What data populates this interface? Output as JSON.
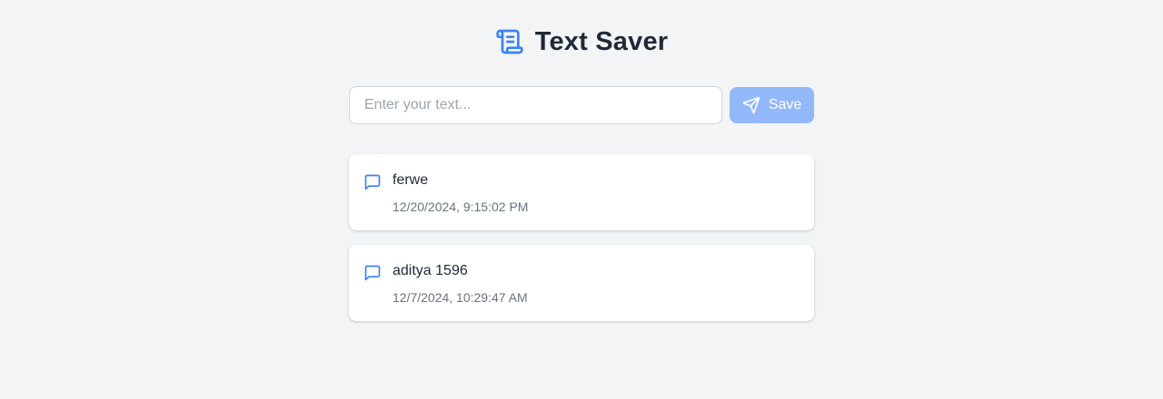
{
  "app": {
    "title": "Text Saver",
    "logo_icon": "scroll-icon",
    "accent_color": "#3b82f6"
  },
  "form": {
    "input_value": "",
    "input_placeholder": "Enter your text...",
    "save_label": "Save",
    "save_icon": "send-icon",
    "save_button_color": "#93b8f9"
  },
  "entries": [
    {
      "text": "ferwe",
      "timestamp": "12/20/2024, 9:15:02 PM",
      "icon": "message-square-icon"
    },
    {
      "text": "aditya 1596",
      "timestamp": "12/7/2024, 10:29:47 AM",
      "icon": "message-square-icon"
    }
  ]
}
